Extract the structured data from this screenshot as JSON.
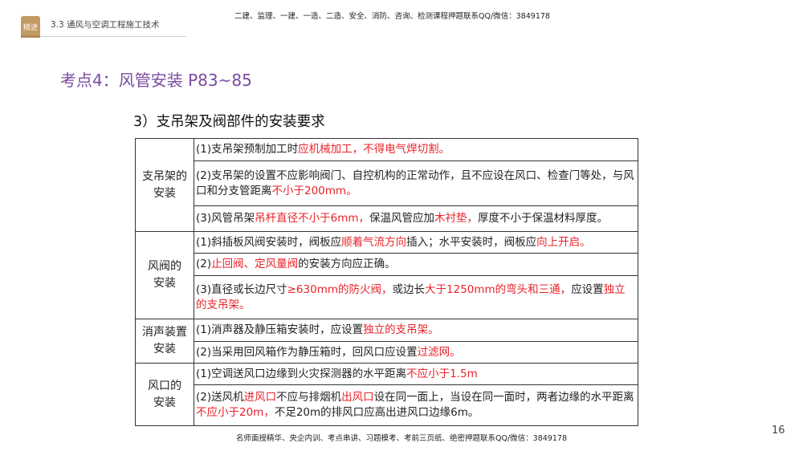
{
  "header": {
    "badge": "精进",
    "section": "3.3 通风与空调工程施工技术",
    "top_note": "二建、监理、一建、一造、二造、安全、消防、咨询、检测课程押题联系QQ/微信：3849178"
  },
  "title": "考点4：风管安装  P83~85",
  "subtitle": "3）支吊架及阀部件的安装要求",
  "groups": [
    {
      "category": "支吊架的安装",
      "items": [
        [
          {
            "t": "(1)支吊架预制加工时"
          },
          {
            "t": "应机械加工，不得电气焊切割。",
            "red": true
          }
        ],
        [
          {
            "t": "(2)支吊架的设置不应影响阀门、自控机构的正常动作，且不应设在风口、检查门等处，与风口和分支管距离"
          },
          {
            "t": "不小于200mm。",
            "red": true
          }
        ],
        [
          {
            "t": "(3)风管吊架"
          },
          {
            "t": "吊杆直径不小于6mm，",
            "red": true
          },
          {
            "t": "保温风管应加"
          },
          {
            "t": "木衬垫，",
            "red": true
          },
          {
            "t": "厚度不小于保温材料厚度。"
          }
        ]
      ]
    },
    {
      "category": "风阀的安装",
      "items": [
        [
          {
            "t": "(1)斜插板风阀安装时，阀板应"
          },
          {
            "t": "顺着气流方向",
            "red": true
          },
          {
            "t": "插入；水平安装时，阀板应"
          },
          {
            "t": "向上开启。",
            "red": true
          }
        ],
        [
          {
            "t": "(2)"
          },
          {
            "t": "止回阀、定风量阀",
            "red": true
          },
          {
            "t": "的安装方向应正确。"
          }
        ],
        [
          {
            "t": "(3)直径或长边尺寸"
          },
          {
            "t": "≥630mm的防火阀，",
            "red": true
          },
          {
            "t": "或边长"
          },
          {
            "t": "大于1250mm的弯头和三通，",
            "red": true
          },
          {
            "t": "应设置"
          },
          {
            "t": "独立的支吊架。",
            "red": true
          }
        ]
      ]
    },
    {
      "category": "消声装置安装",
      "items": [
        [
          {
            "t": "(1)消声器及静压箱安装时，应设置"
          },
          {
            "t": "独立的支吊架。",
            "red": true
          }
        ],
        [
          {
            "t": "(2)当采用回风箱作为静压箱时，回风口应设置"
          },
          {
            "t": "过滤网。",
            "red": true
          }
        ]
      ]
    },
    {
      "category": "风口的安装",
      "items": [
        [
          {
            "t": "(1)空调送风口边缘到火灾探测器的水平距离"
          },
          {
            "t": "不应小于1.5m",
            "red": true
          }
        ],
        [
          {
            "t": "(2)送风机"
          },
          {
            "t": "进风口",
            "red": true
          },
          {
            "t": "不应与排烟机"
          },
          {
            "t": "出风口",
            "red": true
          },
          {
            "t": "设在同一面上，当设在同一面时，两者边缘的水平距离"
          },
          {
            "t": "不应小于20m，",
            "red": true
          },
          {
            "t": "不足20m的排风口应高出进风口边缘6m。"
          }
        ]
      ]
    }
  ],
  "footer": "名师面授精华、央企内训、考点串讲、习题模考、考前三页纸、绝密押题联系QQ/微信：3849178",
  "page_number": "16",
  "colors": {
    "title": "#7b4aa0",
    "highlight": "#e8232a",
    "badge": "#c39a64"
  }
}
